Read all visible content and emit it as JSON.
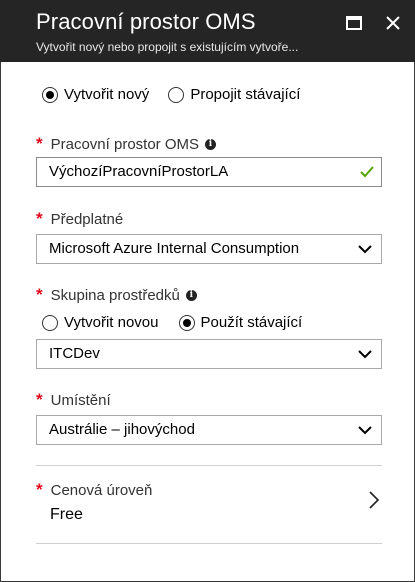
{
  "header": {
    "title": "Pracovní prostor OMS",
    "subtitle": "Vytvořit nový nebo propojit s existujícím vytvoře..."
  },
  "mode": {
    "options": [
      "Vytvořit nový",
      "Propojit stávající"
    ],
    "selected": "Vytvořit nový"
  },
  "workspace": {
    "label": "Pracovní prostor OMS",
    "value": "VýchozíPracovníProstorLA"
  },
  "subscription": {
    "label": "Předplatné",
    "value": "Microsoft Azure Internal Consumption"
  },
  "resource_group": {
    "label": "Skupina prostředků",
    "options": [
      "Vytvořit novou",
      "Použít stávající"
    ],
    "selected": "Použít stávající",
    "value": "ITCDev"
  },
  "location": {
    "label": "Umístění",
    "value": "Austrálie – jihovýchod"
  },
  "pricing_tier": {
    "label": "Cenová úroveň",
    "value": "Free"
  },
  "required_marker": "*",
  "info_glyph": "i",
  "colors": {
    "header_bg": "#252525",
    "required": "#e00b1c",
    "valid_check": "#57a300"
  },
  "icons": {
    "maximize": "maximize-icon",
    "close": "close-icon",
    "dropdown": "chevron-down-icon",
    "valid": "checkmark-icon",
    "navigate": "chevron-right-icon",
    "info": "info-icon"
  }
}
